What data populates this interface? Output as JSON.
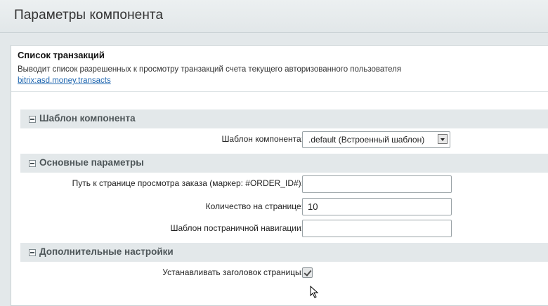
{
  "window": {
    "title": "Параметры компонента"
  },
  "component": {
    "name": "Список транзакций",
    "description": "Выводит список разрешенных к просмотру транзакций счета текущего авторизованного пользователя",
    "link": "bitrix:asd.money.transacts"
  },
  "sections": [
    {
      "title": "Шаблон компонента",
      "rows": [
        {
          "label": "Шаблон компонента:",
          "type": "select",
          "value": ".default (Встроенный шаблон)"
        }
      ]
    },
    {
      "title": "Основные параметры",
      "rows": [
        {
          "label": "Путь к странице просмотра заказа (маркер: #ORDER_ID#):",
          "type": "text",
          "value": ""
        },
        {
          "label": "Количество на странице:",
          "type": "text",
          "value": "10"
        },
        {
          "label": "Шаблон постраничной навигации:",
          "type": "text",
          "value": ""
        }
      ]
    },
    {
      "title": "Дополнительные настройки",
      "rows": [
        {
          "label": "Устанавливать заголовок страницы:",
          "type": "checkbox",
          "checked": true
        }
      ]
    }
  ]
}
